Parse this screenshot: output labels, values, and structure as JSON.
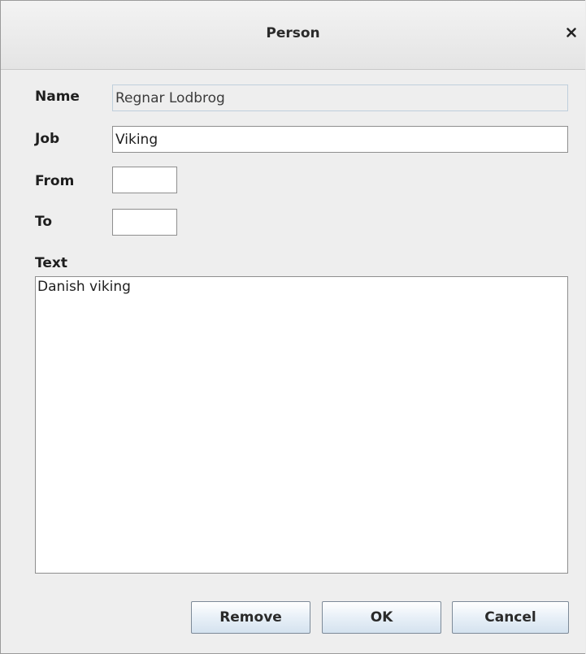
{
  "window": {
    "title": "Person",
    "close_icon": "close-icon"
  },
  "form": {
    "name_label": "Name",
    "name_value": "Regnar Lodbrog",
    "job_label": "Job",
    "job_value": "Viking",
    "from_label": "From",
    "from_value": "",
    "to_label": "To",
    "to_value": "",
    "text_label": "Text",
    "text_value": "Danish viking"
  },
  "buttons": {
    "remove_label": "Remove",
    "ok_label": "OK",
    "cancel_label": "Cancel"
  }
}
